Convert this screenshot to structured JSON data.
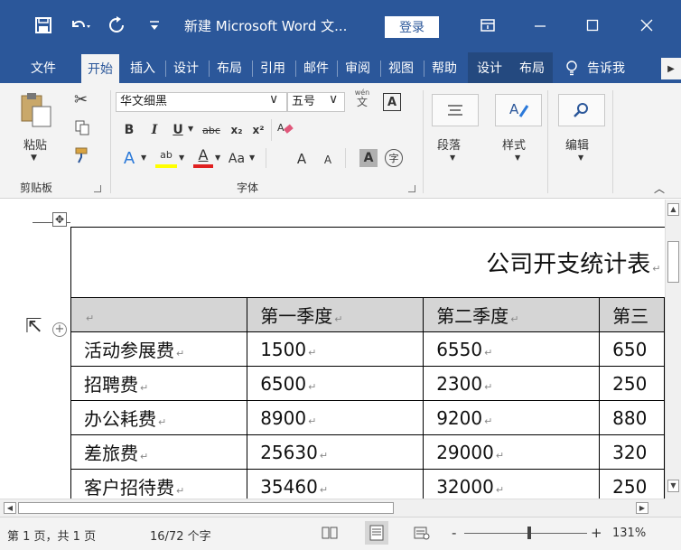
{
  "titlebar": {
    "title": "新建 Microsoft Word 文...",
    "login": "登录",
    "save_icon": "save-icon",
    "undo_icon": "undo-icon",
    "redo_icon": "redo-icon"
  },
  "tabs": [
    "文件",
    "开始",
    "插入",
    "设计",
    "布局",
    "引用",
    "邮件",
    "审阅",
    "视图",
    "帮助",
    "设计",
    "布局",
    "告诉我"
  ],
  "ribbon": {
    "clipboard": {
      "paste": "粘贴",
      "label": "剪贴板"
    },
    "font": {
      "name": "华文细黑",
      "size": "五号",
      "phonetic_top": "wén",
      "phonetic_char": "文",
      "boxed": "A",
      "bold": "B",
      "italic": "I",
      "underline": "U",
      "strike": "abc",
      "sub": "x₂",
      "sup": "x²",
      "font_color": "A",
      "highlight": "ab",
      "text_color": "A",
      "case": "Aa",
      "grow": "A",
      "shrink": "A",
      "char_shading": "A",
      "enclose": "字",
      "label": "字体"
    },
    "paragraph": "段落",
    "styles": "样式",
    "editing": "编辑"
  },
  "document": {
    "table_title": "公司开支统计表",
    "header": [
      "",
      "第一季度",
      "第二季度",
      "第三"
    ],
    "rows": [
      [
        "活动参展费",
        "1500",
        "6550",
        "650"
      ],
      [
        "招聘费",
        "6500",
        "2300",
        "250"
      ],
      [
        "办公耗费",
        "8900",
        "9200",
        "880"
      ],
      [
        "差旅费",
        "25630",
        "29000",
        "320"
      ],
      [
        "客户招待费",
        "35460",
        "32000",
        "250"
      ]
    ],
    "para_mark": "↵"
  },
  "status": {
    "page": "第 1 页，共 1 页",
    "words": "16/72 个字",
    "zoom_minus": "-",
    "zoom_plus": "+",
    "zoom": "131%"
  }
}
